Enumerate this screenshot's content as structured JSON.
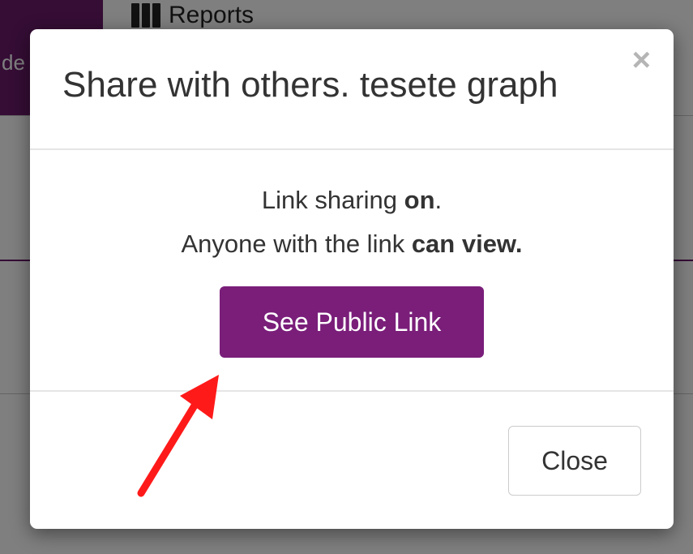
{
  "background": {
    "tab_partial_label": "de",
    "reports_label": "Reports",
    "reports_icon": "book-icon"
  },
  "modal": {
    "title": "Share with others. tesete graph",
    "close_icon": "close-icon",
    "close_glyph": "×",
    "body": {
      "line1_prefix": "Link sharing ",
      "line1_bold": "on",
      "line1_suffix": ".",
      "line2_prefix": "Anyone with the link ",
      "line2_bold": "can view."
    },
    "public_link_button": "See Public Link",
    "close_button": "Close"
  },
  "annotation": {
    "type": "arrow",
    "color": "#ff1a1a",
    "target": "See Public Link"
  },
  "colors": {
    "accent": "#7a1e7a",
    "annotation": "#ff1a1a"
  }
}
